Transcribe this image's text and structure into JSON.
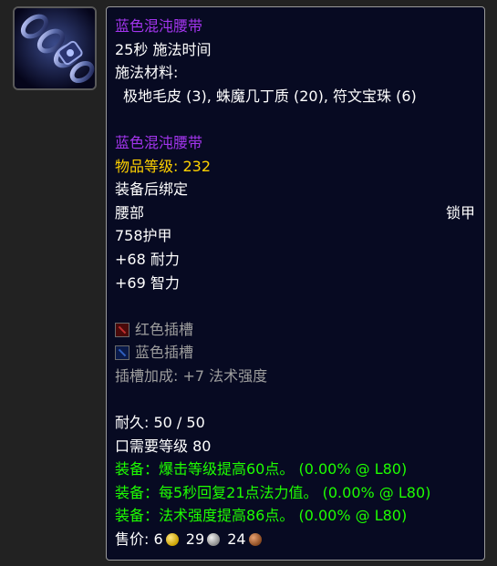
{
  "item": {
    "icon": "chain-belt-icon",
    "recipe_title": "蓝色混沌腰带",
    "cast_time": "25秒 施法时间",
    "materials_label": "施法材料:",
    "materials": "极地毛皮 (3), 蛛魔几丁质 (20), 符文宝珠 (6)",
    "name": "蓝色混沌腰带",
    "item_level_label": "物品等级:",
    "item_level_value": "232",
    "bind": "装备后绑定",
    "slot": "腰部",
    "armor_type": "锁甲",
    "armor": "758护甲",
    "stats": [
      "+68 耐力",
      "+69 智力"
    ],
    "sockets": [
      {
        "color": "red",
        "icon": "red-socket-icon",
        "label": "红色插槽"
      },
      {
        "color": "blue",
        "icon": "blue-socket-icon",
        "label": "蓝色插槽"
      }
    ],
    "socket_bonus": "插槽加成: +7 法术强度",
    "durability": "耐久: 50 / 50",
    "requires_level": "口需要等级 80",
    "equip_effects": [
      "装备：爆击等级提高60点。 (0.00% @ L80)",
      "装备：每5秒回复21点法力值。 (0.00% @ L80)",
      "装备：法术强度提高86点。 (0.00% @ L80)"
    ],
    "sell_price": {
      "label": "售价:",
      "gold": "6",
      "silver": "29",
      "copper": "24"
    },
    "colors": {
      "epic_purple": "#a335ee",
      "item_level_gold": "#ffd100",
      "socket_gray": "#9d9d9d",
      "equip_green": "#1eff00",
      "tooltip_bg": "#070a22"
    }
  }
}
